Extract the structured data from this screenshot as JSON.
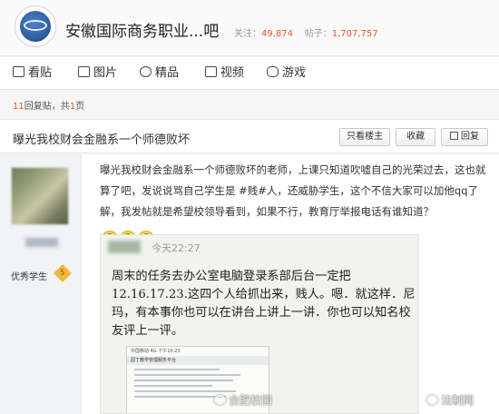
{
  "header": {
    "bar_title": "安徽国际商务职业...吧",
    "follow_label": "关注：",
    "follow_count": "49,874",
    "posts_label": "帖子：",
    "posts_count": "1,707,757"
  },
  "nav": {
    "items": [
      {
        "label": "看贴",
        "icon": "doc-icon"
      },
      {
        "label": "图片",
        "icon": "image-icon"
      },
      {
        "label": "精品",
        "icon": "star-icon"
      },
      {
        "label": "视频",
        "icon": "video-icon"
      },
      {
        "label": "游戏",
        "icon": "gamepad-icon"
      }
    ]
  },
  "page_info": {
    "reply_count": "11",
    "reply_suffix": "回复贴，共",
    "page_count": "1",
    "page_suffix": "页"
  },
  "thread": {
    "title": "曝光我校财会金融系一个师德败坏",
    "buttons": {
      "author_only": "只看楼主",
      "favorite": "收藏",
      "reply": "回复"
    }
  },
  "post": {
    "author_badge": "优秀学生",
    "author_level": "5",
    "text": "曝光我校财会金融系一个师德败坏的老师，上课只知道吹嘘自己的光荣过去，这也就算了吧，发说说骂自己学生是 #贱#人，还威胁学生，这个不信大家可以加他qq了解，我发帖就是希望校领导看到，如果不行，教育厅举报电话有谁知道？",
    "emojis": [
      "😅",
      "😅",
      "😅"
    ]
  },
  "screenshot": {
    "time": "今天22:27",
    "text": "周末的任务去办公室电脑登录系部后台一定把12.16.17.23.这四个人给抓出来，贱人。嗯．就这样．尼玛，有本事你也可以在讲台上讲上一讲．你也可以知名校友评上一评。",
    "phone_status": "中国移动    4G    下午10:23",
    "phone_app": "园丁教学管理服务平台"
  },
  "watermarks": [
    "合肥校园",
    "法制网"
  ]
}
